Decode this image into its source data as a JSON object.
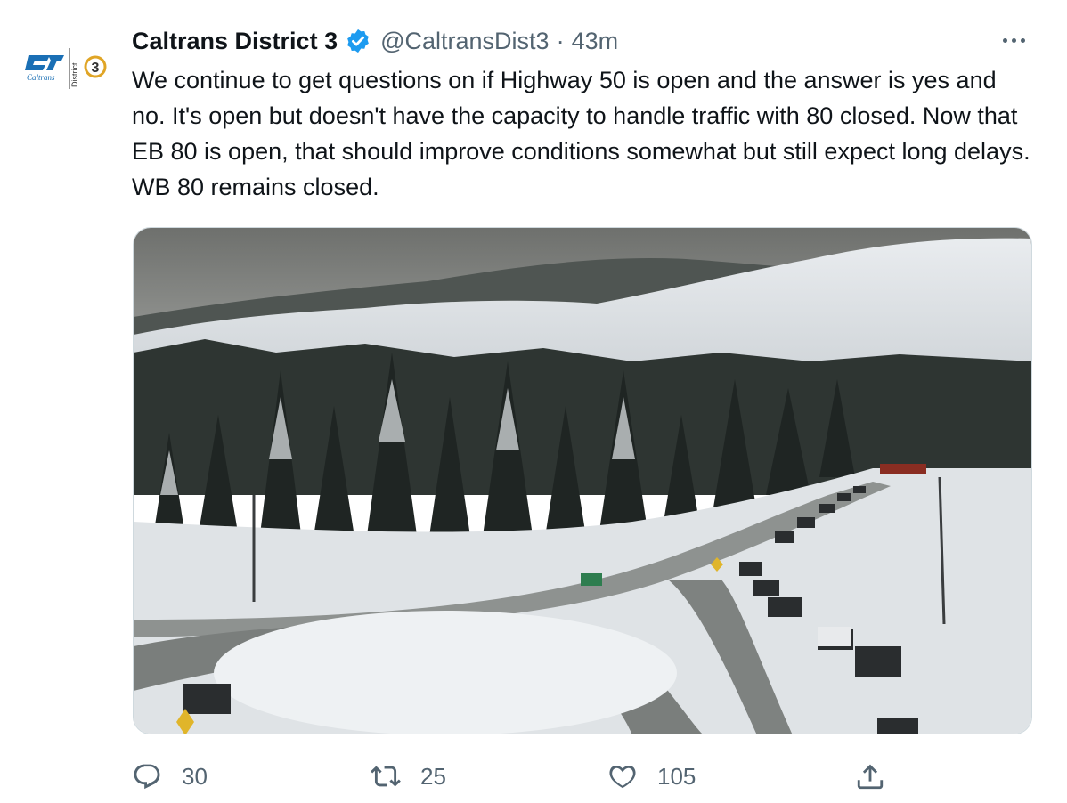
{
  "author": {
    "display_name": "Caltrans District 3",
    "handle": "@CaltransDist3",
    "separator": "·",
    "time": "43m",
    "verified": true,
    "avatar": {
      "logo_text": "Caltrans",
      "side_text": "District",
      "number": "3"
    }
  },
  "tweet": {
    "text": "We continue to get questions on if Highway 50 is open and the answer is yes and no. It's open but doesn't have the capacity to handle traffic with 80 closed. Now that EB 80 is open, that should improve conditions somewhat but still expect long delays. WB 80 remains closed.",
    "media_icon": "traffic-camera-photo"
  },
  "actions": {
    "reply": {
      "icon": "reply-icon",
      "count": "30"
    },
    "retweet": {
      "icon": "retweet-icon",
      "count": "25"
    },
    "like": {
      "icon": "heart-icon",
      "count": "105"
    },
    "share": {
      "icon": "share-icon"
    }
  },
  "colors": {
    "text_primary": "#0f1419",
    "text_secondary": "#536471",
    "verified_blue": "#1d9bf0",
    "border": "#cfd9de",
    "caltrans_blue": "#1a6fb5",
    "district_gold": "#e0a526"
  }
}
